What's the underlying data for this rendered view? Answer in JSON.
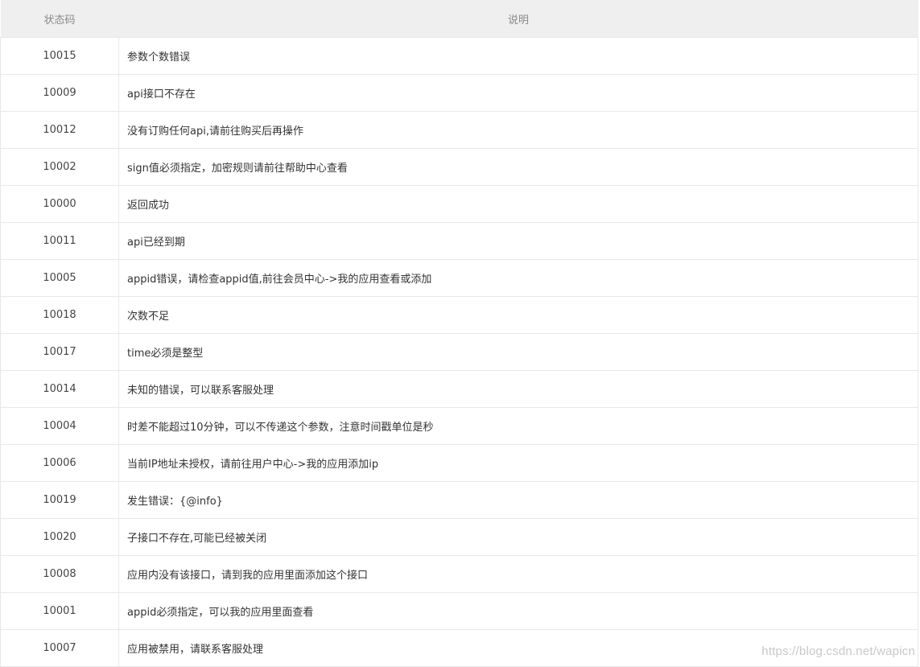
{
  "table": {
    "headers": {
      "code": "状态码",
      "description": "说明"
    },
    "rows": [
      {
        "code": "10015",
        "description": "参数个数错误"
      },
      {
        "code": "10009",
        "description": "api接口不存在"
      },
      {
        "code": "10012",
        "description": "没有订购任何api,请前往购买后再操作"
      },
      {
        "code": "10002",
        "description": "sign值必须指定，加密规则请前往帮助中心查看"
      },
      {
        "code": "10000",
        "description": "返回成功"
      },
      {
        "code": "10011",
        "description": "api已经到期"
      },
      {
        "code": "10005",
        "description": "appid错误，请检查appid值,前往会员中心->我的应用查看或添加"
      },
      {
        "code": "10018",
        "description": "次数不足"
      },
      {
        "code": "10017",
        "description": "time必须是整型"
      },
      {
        "code": "10014",
        "description": "未知的错误，可以联系客服处理"
      },
      {
        "code": "10004",
        "description": "时差不能超过10分钟，可以不传递这个参数，注意时间戳单位是秒"
      },
      {
        "code": "10006",
        "description": "当前IP地址未授权，请前往用户中心->我的应用添加ip"
      },
      {
        "code": "10019",
        "description": "发生错误：{@info}"
      },
      {
        "code": "10020",
        "description": "子接口不存在,可能已经被关闭"
      },
      {
        "code": "10008",
        "description": "应用内没有该接口，请到我的应用里面添加这个接口"
      },
      {
        "code": "10001",
        "description": "appid必须指定，可以我的应用里面查看"
      },
      {
        "code": "10007",
        "description": "应用被禁用，请联系客服处理"
      }
    ]
  },
  "watermark": "https://blog.csdn.net/wapicn"
}
